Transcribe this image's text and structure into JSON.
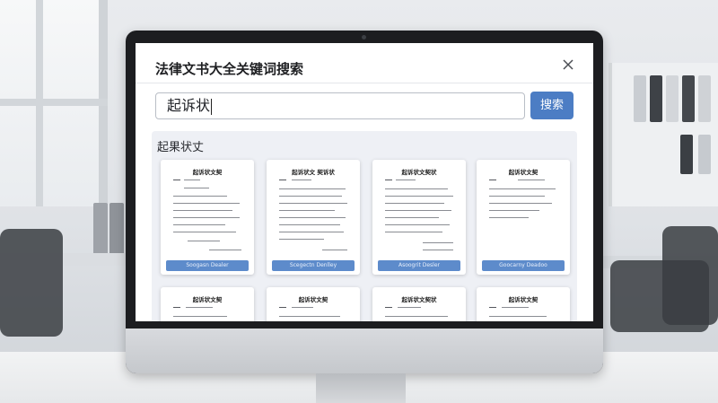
{
  "dialog": {
    "title": "法律文书大全关键词搜索",
    "close_icon": "close-icon"
  },
  "search": {
    "value": "起诉状",
    "button_label": "搜索"
  },
  "results": {
    "heading": "起果状丈",
    "cards": [
      {
        "title": "起诉状文契",
        "button": "Soogasn Dealer"
      },
      {
        "title": "起诉状文 契诉状",
        "button": "Scegectn Denlley"
      },
      {
        "title": "起诉状文契状",
        "button": "Asoogrit Desler"
      },
      {
        "title": "起诉状文契",
        "button": "Goocarny Deadoo"
      },
      {
        "title": "起诉状文契",
        "button": ""
      },
      {
        "title": "起诉状文契",
        "button": ""
      },
      {
        "title": "起诉状文契状",
        "button": ""
      },
      {
        "title": "起诉状文契",
        "button": ""
      }
    ]
  },
  "colors": {
    "accent": "#4c7dc4",
    "card_button": "#5d8bcb",
    "panel": "#eef0f5"
  }
}
